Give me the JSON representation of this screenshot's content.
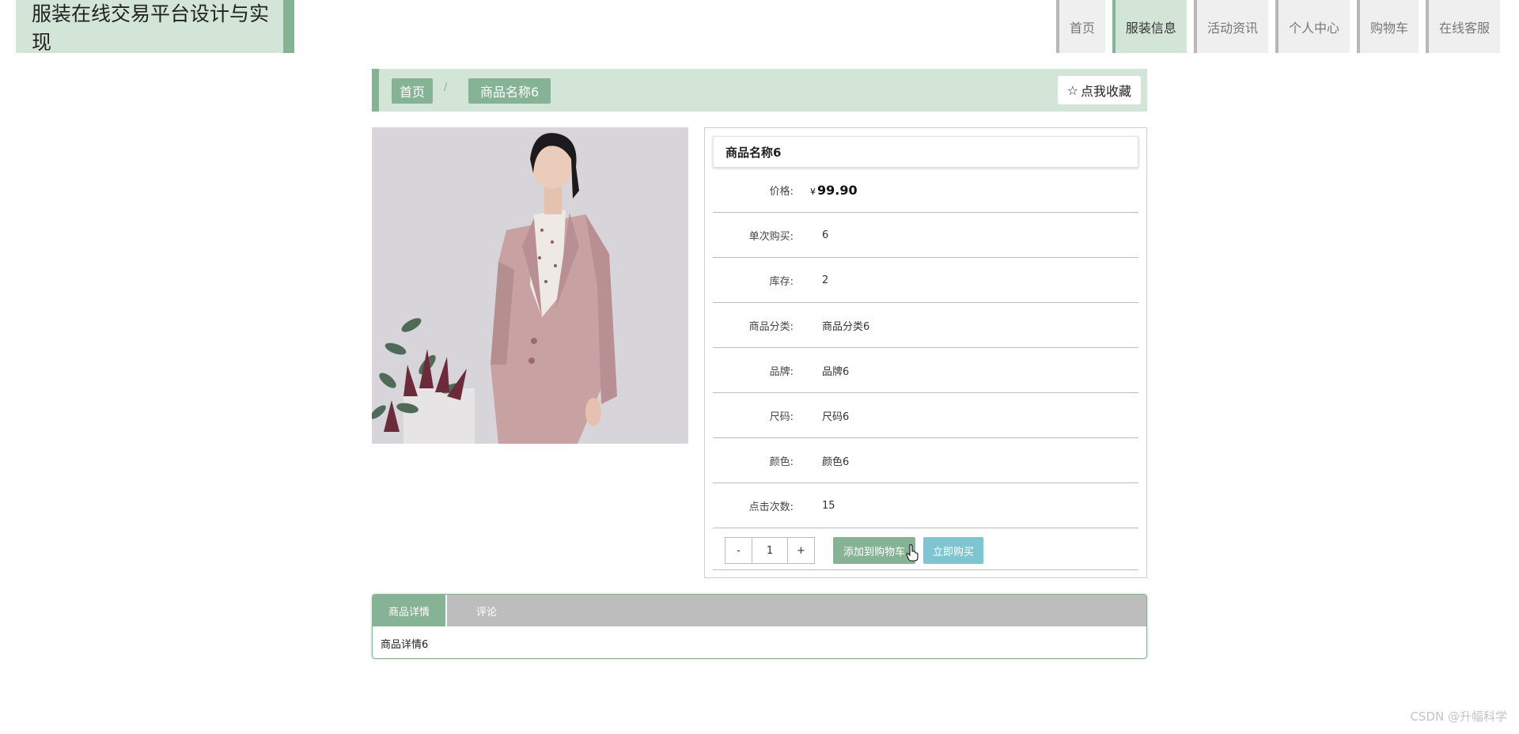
{
  "header": {
    "site_title": "服装在线交易平台设计与实现",
    "nav": [
      {
        "label": "首页",
        "active": false
      },
      {
        "label": "服装信息",
        "active": true
      },
      {
        "label": "活动资讯",
        "active": false
      },
      {
        "label": "个人中心",
        "active": false
      },
      {
        "label": "购物车",
        "active": false
      },
      {
        "label": "在线客服",
        "active": false
      }
    ]
  },
  "breadcrumb": {
    "home": "首页",
    "separator": "/",
    "current": "商品名称6",
    "favorite_label": "点我收藏",
    "favorite_icon": "star-outline-icon"
  },
  "product": {
    "name": "商品名称6",
    "price_label": "价格:",
    "currency": "¥",
    "price": "99.90",
    "fields": [
      {
        "label": "单次购买:",
        "value": "6"
      },
      {
        "label": "库存:",
        "value": "2"
      },
      {
        "label": "商品分类:",
        "value": "商品分类6"
      },
      {
        "label": "品牌:",
        "value": "品牌6"
      },
      {
        "label": "尺码:",
        "value": "尺码6"
      },
      {
        "label": "颜色:",
        "value": "颜色6"
      },
      {
        "label": "点击次数:",
        "value": "15"
      }
    ]
  },
  "purchase": {
    "minus": "-",
    "quantity": "1",
    "plus": "+",
    "add_to_cart": "添加到购物车",
    "buy_now": "立即购买"
  },
  "tabs": {
    "items": [
      {
        "label": "商品详情",
        "active": true
      },
      {
        "label": "评论",
        "active": false
      }
    ],
    "content": "商品详情6"
  },
  "watermark": "CSDN @升幅科学",
  "colors": {
    "accent": "#86b396",
    "accent_light": "#d3e5d6",
    "buy_button": "#7ec5d1"
  }
}
